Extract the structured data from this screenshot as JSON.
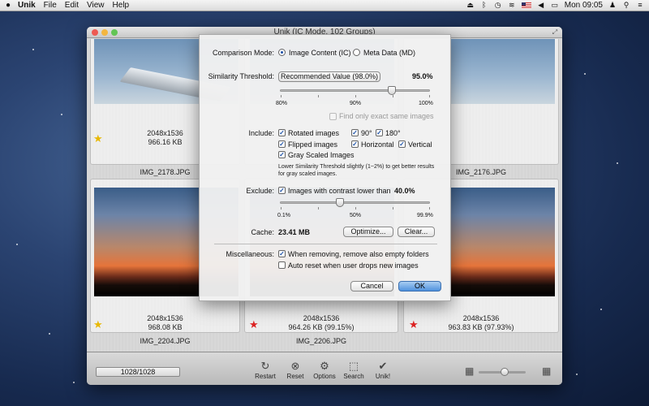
{
  "menubar": {
    "app": "Unik",
    "items": [
      "File",
      "Edit",
      "View",
      "Help"
    ],
    "clock": "Mon 09:05"
  },
  "window": {
    "title": "Unik (IC Mode, 102 Groups)"
  },
  "cards": [
    {
      "dims": "2048x1536",
      "size": "966.16 KB",
      "file": "IMG_2178.JPG",
      "star": "gold"
    },
    {
      "file": "IMG_2176.JPG"
    },
    {
      "dims": "2048x1536",
      "size": "968.08 KB",
      "file": "IMG_2204.JPG",
      "star": "gold"
    },
    {
      "dims": "2048x1536",
      "size": "964.26 KB (99.15%)",
      "file": "IMG_2206.JPG",
      "star": "red"
    },
    {
      "dims": "2048x1536",
      "size": "963.83 KB (97.93%)",
      "star": "red"
    }
  ],
  "dialog": {
    "comparison_label": "Comparison Mode:",
    "mode_image": "Image Content (IC)",
    "mode_meta": "Meta Data (MD)",
    "mode_selected": "image",
    "threshold_label": "Similarity Threshold:",
    "threshold_button": "Recommended Value (98.0%)",
    "threshold_value": "95.0%",
    "threshold_fraction": 0.75,
    "threshold_ticks": [
      "80%",
      "90%",
      "100%"
    ],
    "exact_only": "Find only exact same images",
    "include_label": "Include:",
    "rotated": "Rotated images",
    "deg90": "90°",
    "deg180": "180°",
    "flipped": "Flipped images",
    "horizontal": "Horizontal",
    "vertical": "Vertical",
    "grayscale": "Gray Scaled Images",
    "note": "Lower Similarity Threshold slightly (1~2%) to get better results for gray scaled images.",
    "exclude_label": "Exclude:",
    "contrast_text": "Images with contrast lower than",
    "contrast_value": "40.0%",
    "contrast_fraction": 0.4,
    "contrast_ticks": [
      "0.1%",
      "50%",
      "99.9%"
    ],
    "cache_label": "Cache:",
    "cache_value": "23.41 MB",
    "optimize": "Optimize...",
    "clear": "Clear...",
    "misc_label": "Miscellaneous:",
    "remove_folders": "When removing, remove also empty folders",
    "auto_reset": "Auto reset when user drops new images",
    "cancel": "Cancel",
    "ok": "OK"
  },
  "toolbar": {
    "counter": "1028/1028",
    "restart": "Restart",
    "reset": "Reset",
    "options": "Options",
    "search": "Search",
    "unik": "Unik!",
    "zoom_fraction": 0.55
  }
}
